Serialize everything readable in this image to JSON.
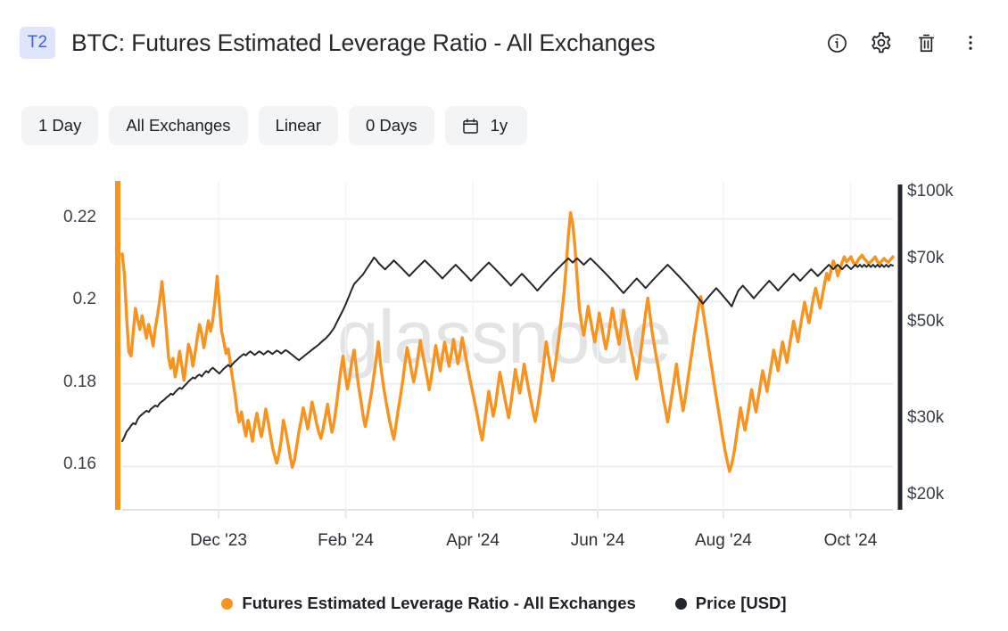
{
  "header": {
    "tier_badge": "T2",
    "title": "BTC: Futures Estimated Leverage Ratio - All Exchanges",
    "actions": [
      {
        "name": "info-icon",
        "label": "Info"
      },
      {
        "name": "gear-icon",
        "label": "Settings"
      },
      {
        "name": "trash-icon",
        "label": "Delete"
      },
      {
        "name": "more-vertical-icon",
        "label": "More options"
      }
    ]
  },
  "toolbar": {
    "resolution": "1 Day",
    "exchange": "All Exchanges",
    "scale": "Linear",
    "smoothing": "0 Days",
    "timeframe": "1y",
    "calendar_icon": "calendar-icon"
  },
  "watermark": "glassnode",
  "colors": {
    "metric": "#f7931e",
    "price": "#23262b",
    "accent": "#4063d8",
    "badge_bg": "#dfe6fb",
    "grid": "#edeef0",
    "pill_bg": "#f3f4f6"
  },
  "legend": [
    {
      "label": "Futures Estimated Leverage Ratio - All Exchanges",
      "color": "#f7931e"
    },
    {
      "label": "Price [USD]",
      "color": "#23262b"
    }
  ],
  "chart_data": {
    "type": "line",
    "title": "BTC: Futures Estimated Leverage Ratio - All Exchanges",
    "xlabel": "",
    "ylabel_left": "Futures Estimated Leverage Ratio",
    "ylabel_right": "Price [USD]",
    "grid": true,
    "legend_position": "bottom-center",
    "x_ticks": [
      "Dec '23",
      "Feb '24",
      "Apr '24",
      "Jun '24",
      "Aug '24",
      "Oct '24"
    ],
    "x_tick_fractions": [
      0.125,
      0.29,
      0.455,
      0.617,
      0.78,
      0.945
    ],
    "y_left": {
      "ticks": [
        0.22,
        0.2,
        0.18,
        0.16
      ],
      "tick_labels": [
        "0.22",
        "0.2",
        "0.18",
        "0.16"
      ],
      "range": [
        0.1495,
        0.2292
      ],
      "scale": "linear",
      "axis_color": "#f7931e"
    },
    "y_right": {
      "ticks": [
        100000,
        70000,
        50000,
        30000,
        20000
      ],
      "tick_labels": [
        "$100k",
        "$70k",
        "$50k",
        "$30k",
        "$20k"
      ],
      "range": [
        18600,
        107000
      ],
      "scale": "log",
      "axis_color": "#23262b"
    },
    "series": [
      {
        "name": "Futures Estimated Leverage Ratio - All Exchanges",
        "axis": "left",
        "color": "#f7931e",
        "values": [
          0.2115,
          0.2066,
          0.1962,
          0.1878,
          0.1868,
          0.1925,
          0.1983,
          0.1956,
          0.1932,
          0.1965,
          0.1938,
          0.1911,
          0.1944,
          0.1919,
          0.1892,
          0.1936,
          0.1967,
          0.2003,
          0.2048,
          0.1992,
          0.1932,
          0.1864,
          0.1838,
          0.1862,
          0.1817,
          0.1846,
          0.1879,
          0.1843,
          0.1809,
          0.1851,
          0.1896,
          0.1878,
          0.1843,
          0.1875,
          0.1912,
          0.1944,
          0.1921,
          0.1888,
          0.1921,
          0.1953,
          0.1928,
          0.1954,
          0.2002,
          0.2061,
          0.1993,
          0.1928,
          0.1902,
          0.1874,
          0.1885,
          0.1849,
          0.1812,
          0.1778,
          0.1735,
          0.1708,
          0.1732,
          0.1699,
          0.1674,
          0.1712,
          0.1688,
          0.1661,
          0.1702,
          0.1729,
          0.1698,
          0.1672,
          0.1701,
          0.1739,
          0.1712,
          0.1679,
          0.1648,
          0.1626,
          0.1608,
          0.1631,
          0.1664,
          0.1712,
          0.1688,
          0.1657,
          0.1627,
          0.1598,
          0.1615,
          0.1649,
          0.1684,
          0.1712,
          0.1742,
          0.1718,
          0.1691,
          0.1722,
          0.1756,
          0.1731,
          0.1705,
          0.1683,
          0.1668,
          0.1693,
          0.1722,
          0.1751,
          0.1712,
          0.1683,
          0.1709,
          0.1748,
          0.1791,
          0.1834,
          0.1867,
          0.1821,
          0.1788,
          0.1817,
          0.1856,
          0.1882,
          0.1838,
          0.1795,
          0.1763,
          0.1726,
          0.1697,
          0.1721,
          0.1753,
          0.1784,
          0.1822,
          0.1861,
          0.1902,
          0.1848,
          0.1806,
          0.1772,
          0.1741,
          0.1712,
          0.1688,
          0.1666,
          0.1702,
          0.1738,
          0.1771,
          0.1806,
          0.1847,
          0.1888,
          0.1862,
          0.1831,
          0.1805,
          0.1832,
          0.1868,
          0.1905,
          0.1874,
          0.1846,
          0.1818,
          0.1786,
          0.1817,
          0.1855,
          0.1893,
          0.1861,
          0.1832,
          0.1868,
          0.1901,
          0.1872,
          0.1843,
          0.1872,
          0.1908,
          0.1878,
          0.1849,
          0.1876,
          0.1912,
          0.1882,
          0.1852,
          0.1824,
          0.1798,
          0.1772,
          0.1746,
          0.1718,
          0.1688,
          0.1664,
          0.1703,
          0.1742,
          0.1782,
          0.1752,
          0.1722,
          0.1748,
          0.1789,
          0.1828,
          0.1801,
          0.1772,
          0.1745,
          0.1718,
          0.1752,
          0.1792,
          0.1835,
          0.1806,
          0.1778,
          0.1809,
          0.1848,
          0.1818,
          0.1788,
          0.1761,
          0.1734,
          0.1709,
          0.1738,
          0.1774,
          0.1812,
          0.1856,
          0.1902,
          0.1868,
          0.1836,
          0.1808,
          0.1842,
          0.1881,
          0.1922,
          0.1968,
          0.2018,
          0.2082,
          0.2158,
          0.2215,
          0.2188,
          0.2134,
          0.2056,
          0.1984,
          0.1945,
          0.1918,
          0.1952,
          0.1988,
          0.1958,
          0.1928,
          0.1902,
          0.1934,
          0.1972,
          0.1943,
          0.1912,
          0.1885,
          0.1912,
          0.1948,
          0.1983,
          0.1952,
          0.1923,
          0.1896,
          0.1938,
          0.1978,
          0.1948,
          0.1918,
          0.1892,
          0.1866,
          0.1838,
          0.1812,
          0.1848,
          0.1886,
          0.1928,
          0.1972,
          0.2008,
          0.1966,
          0.1925,
          0.1892,
          0.1861,
          0.1832,
          0.1798,
          0.1766,
          0.1738,
          0.1708,
          0.1742,
          0.1778,
          0.1812,
          0.1848,
          0.1802,
          0.1768,
          0.1735,
          0.1768,
          0.1805,
          0.1842,
          0.1878,
          0.1918,
          0.1952,
          0.1988,
          0.2012,
          0.1978,
          0.1942,
          0.1908,
          0.1872,
          0.1838,
          0.1802,
          0.1768,
          0.1736,
          0.1702,
          0.1668,
          0.1638,
          0.1612,
          0.1588,
          0.1605,
          0.1632,
          0.1668,
          0.1705,
          0.1742,
          0.1712,
          0.1688,
          0.1718,
          0.1752,
          0.1786,
          0.1758,
          0.1732,
          0.1765,
          0.1798,
          0.1832,
          0.1808,
          0.1782,
          0.1815,
          0.1848,
          0.1882,
          0.1858,
          0.1832,
          0.1868,
          0.1902,
          0.1878,
          0.1852,
          0.1886,
          0.1918,
          0.1952,
          0.1928,
          0.1902,
          0.1936,
          0.1968,
          0.1998,
          0.1972,
          0.1948,
          0.1978,
          0.2008,
          0.2032,
          0.2008,
          0.1984,
          0.2012,
          0.2042,
          0.2068,
          0.2052,
          0.2076,
          0.2098,
          0.2085,
          0.2062,
          0.2078,
          0.2095,
          0.2108,
          0.2096,
          0.2102,
          0.2108,
          0.2095,
          0.2088,
          0.2098,
          0.2106,
          0.2112,
          0.2104,
          0.2098,
          0.2092,
          0.2096,
          0.2102,
          0.2108,
          0.2096,
          0.2092,
          0.2098,
          0.2104,
          0.2098,
          0.2095,
          0.2102,
          0.2108
        ]
      },
      {
        "name": "Price [USD]",
        "axis": "right",
        "color": "#23262b",
        "values": [
          26800,
          27400,
          28200,
          28600,
          29100,
          29500,
          29300,
          30100,
          30600,
          30900,
          31200,
          31500,
          31300,
          31800,
          32100,
          32400,
          32200,
          32800,
          33100,
          33400,
          33800,
          34100,
          34500,
          34300,
          34800,
          35200,
          35600,
          35400,
          35900,
          36300,
          36800,
          37200,
          37600,
          37400,
          37900,
          38200,
          37800,
          38400,
          38900,
          38600,
          39200,
          39600,
          39200,
          38800,
          38400,
          38900,
          39400,
          39800,
          40200,
          39800,
          40400,
          40900,
          41300,
          41800,
          42200,
          42600,
          42300,
          42800,
          43200,
          42800,
          42400,
          42800,
          43200,
          42900,
          42500,
          42900,
          43300,
          43000,
          42600,
          43000,
          43400,
          43100,
          42700,
          43100,
          43500,
          43200,
          42800,
          42400,
          42000,
          41600,
          41200,
          41600,
          42000,
          42400,
          42800,
          43200,
          43600,
          44000,
          44400,
          44800,
          45300,
          45800,
          46200,
          46800,
          47400,
          48200,
          49000,
          50200,
          51400,
          52600,
          53800,
          55200,
          56800,
          58400,
          60200,
          61800,
          62600,
          63400,
          64200,
          65000,
          66200,
          67400,
          68600,
          69800,
          71200,
          70400,
          69200,
          68400,
          67600,
          66800,
          67600,
          68400,
          69200,
          70100,
          69300,
          68500,
          67700,
          66900,
          66100,
          65300,
          64500,
          65300,
          66100,
          66900,
          67700,
          68500,
          69300,
          70100,
          69300,
          68500,
          67700,
          66900,
          66100,
          65300,
          64500,
          63700,
          64500,
          65300,
          66100,
          66900,
          67700,
          68500,
          67700,
          66900,
          66100,
          65300,
          64500,
          63700,
          62900,
          63700,
          64500,
          65300,
          66100,
          66900,
          67700,
          68500,
          69300,
          68500,
          67700,
          66900,
          66100,
          65300,
          64500,
          63700,
          62900,
          62100,
          61300,
          62100,
          62900,
          63700,
          64500,
          65300,
          64500,
          63700,
          62900,
          62100,
          61300,
          60500,
          59700,
          60500,
          61300,
          62100,
          62900,
          63700,
          64500,
          65300,
          66100,
          66900,
          67700,
          68500,
          69300,
          70100,
          70900,
          70100,
          69300,
          70100,
          70900,
          70100,
          69300,
          68500,
          69300,
          70100,
          70900,
          70100,
          69300,
          68500,
          67700,
          66900,
          66100,
          65300,
          64500,
          63700,
          62900,
          62100,
          61300,
          60500,
          59700,
          58900,
          59700,
          60500,
          61300,
          62100,
          62900,
          63700,
          62900,
          62100,
          61300,
          60500,
          61300,
          62100,
          62900,
          63700,
          64500,
          65300,
          66100,
          66900,
          67700,
          68500,
          67700,
          66900,
          66100,
          65300,
          64500,
          63700,
          62900,
          62100,
          61300,
          60500,
          59700,
          58900,
          58100,
          57300,
          56500,
          55700,
          56500,
          57300,
          58100,
          58900,
          59700,
          60500,
          59700,
          58900,
          58100,
          57300,
          56500,
          55700,
          54900,
          56500,
          58100,
          59700,
          60500,
          61300,
          60500,
          59700,
          58900,
          58100,
          57300,
          58100,
          58900,
          59700,
          60500,
          61300,
          62100,
          62900,
          62100,
          61300,
          60500,
          59700,
          60500,
          61300,
          62100,
          62900,
          63700,
          64500,
          65300,
          64500,
          63700,
          62900,
          63700,
          64500,
          65300,
          66100,
          66900,
          66100,
          65300,
          64500,
          65300,
          66100,
          66900,
          67700,
          68500,
          67700,
          66900,
          67700,
          68500,
          67700,
          66900,
          67700,
          68500,
          67700,
          66900,
          67700,
          68500,
          67700,
          68500,
          67700,
          68500,
          67700,
          68500,
          67700,
          68500,
          67700,
          68500,
          67700,
          68500,
          67700,
          68500,
          67700,
          68500,
          68200
        ]
      }
    ]
  }
}
